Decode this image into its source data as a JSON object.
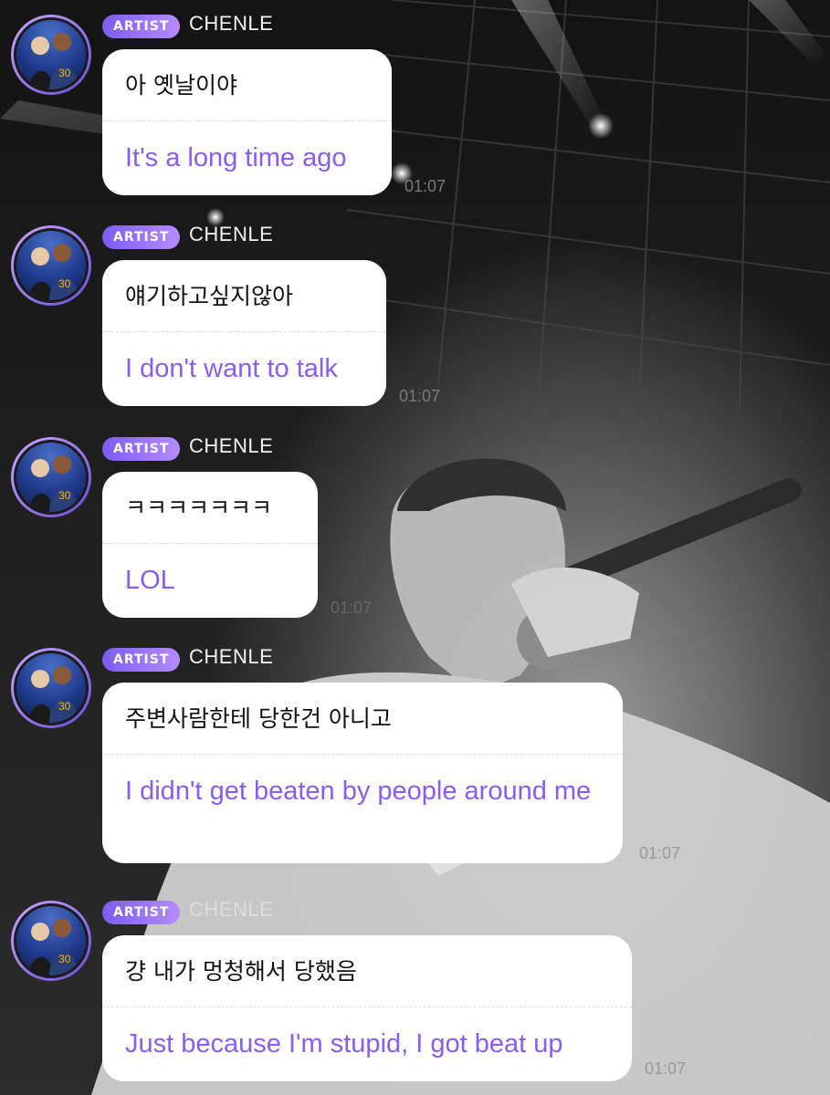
{
  "messages": [
    {
      "badge": "ARTIST",
      "sender": "CHENLE",
      "korean": "아 옛날이야",
      "english": "It's a long time ago",
      "time": "01:07"
    },
    {
      "badge": "ARTIST",
      "sender": "CHENLE",
      "korean": "얘기하고싶지않아",
      "english": "I don't want to talk",
      "time": "01:07"
    },
    {
      "badge": "ARTIST",
      "sender": "CHENLE",
      "korean": "ㅋㅋㅋㅋㅋㅋㅋ",
      "english": "LOL",
      "time": "01:07"
    },
    {
      "badge": "ARTIST",
      "sender": "CHENLE",
      "korean": "주변사람한테 당한건 아니고",
      "english": "I didn't get beaten by people around me",
      "time": "01:07"
    },
    {
      "badge": "ARTIST",
      "sender": "CHENLE",
      "korean": "걍 내가 멍청해서 당했음",
      "english": "Just because I'm stupid, I got beat up",
      "time": "01:07"
    }
  ],
  "colors": {
    "accent": "#8a5cf0",
    "badge_gradient_start": "#7c5cf0",
    "badge_gradient_end": "#b48cff",
    "bubble": "#ffffff",
    "timestamp": "#7a7a7a"
  },
  "background_image": "concert-photo"
}
